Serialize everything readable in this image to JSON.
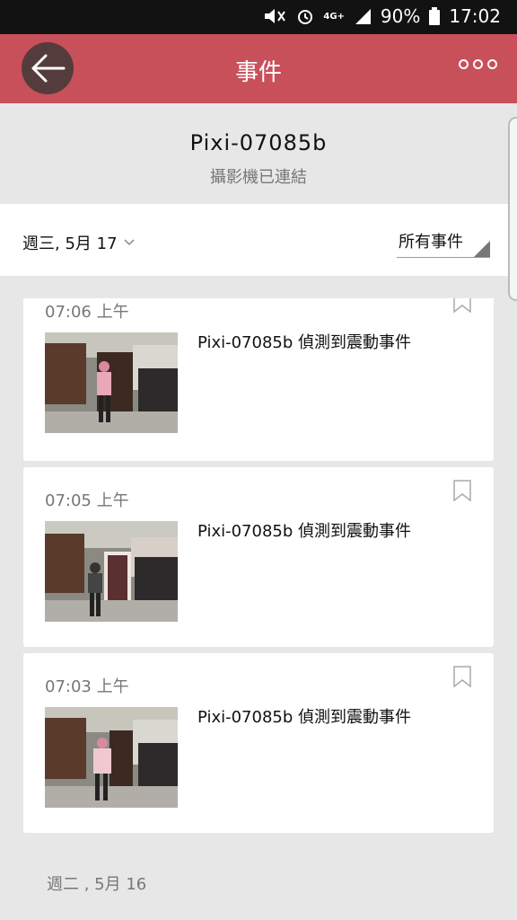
{
  "status_bar": {
    "network": "4G+",
    "battery": "90%",
    "time": "17:02",
    "icons": [
      "mute-icon",
      "alarm-icon",
      "signal-icon",
      "battery-icon"
    ]
  },
  "app_bar": {
    "title": "事件",
    "back_icon": "arrow-left-icon",
    "more_icon": "more-dots-icon"
  },
  "camera": {
    "name": "Pixi-07085b",
    "status": "攝影機已連結"
  },
  "filter": {
    "date": "週三, 5月 17",
    "event_type": "所有事件"
  },
  "events": [
    {
      "time": "07:06 上午",
      "description": "Pixi-07085b 偵測到震動事件"
    },
    {
      "time": "07:05 上午",
      "description": "Pixi-07085b 偵測到震動事件"
    },
    {
      "time": "07:03 上午",
      "description": "Pixi-07085b 偵測到震動事件"
    }
  ],
  "next_day": "週二 , 5月 16",
  "colors": {
    "accent": "#c8505b",
    "back_button": "#553c3c",
    "background": "#e7e7e7"
  }
}
